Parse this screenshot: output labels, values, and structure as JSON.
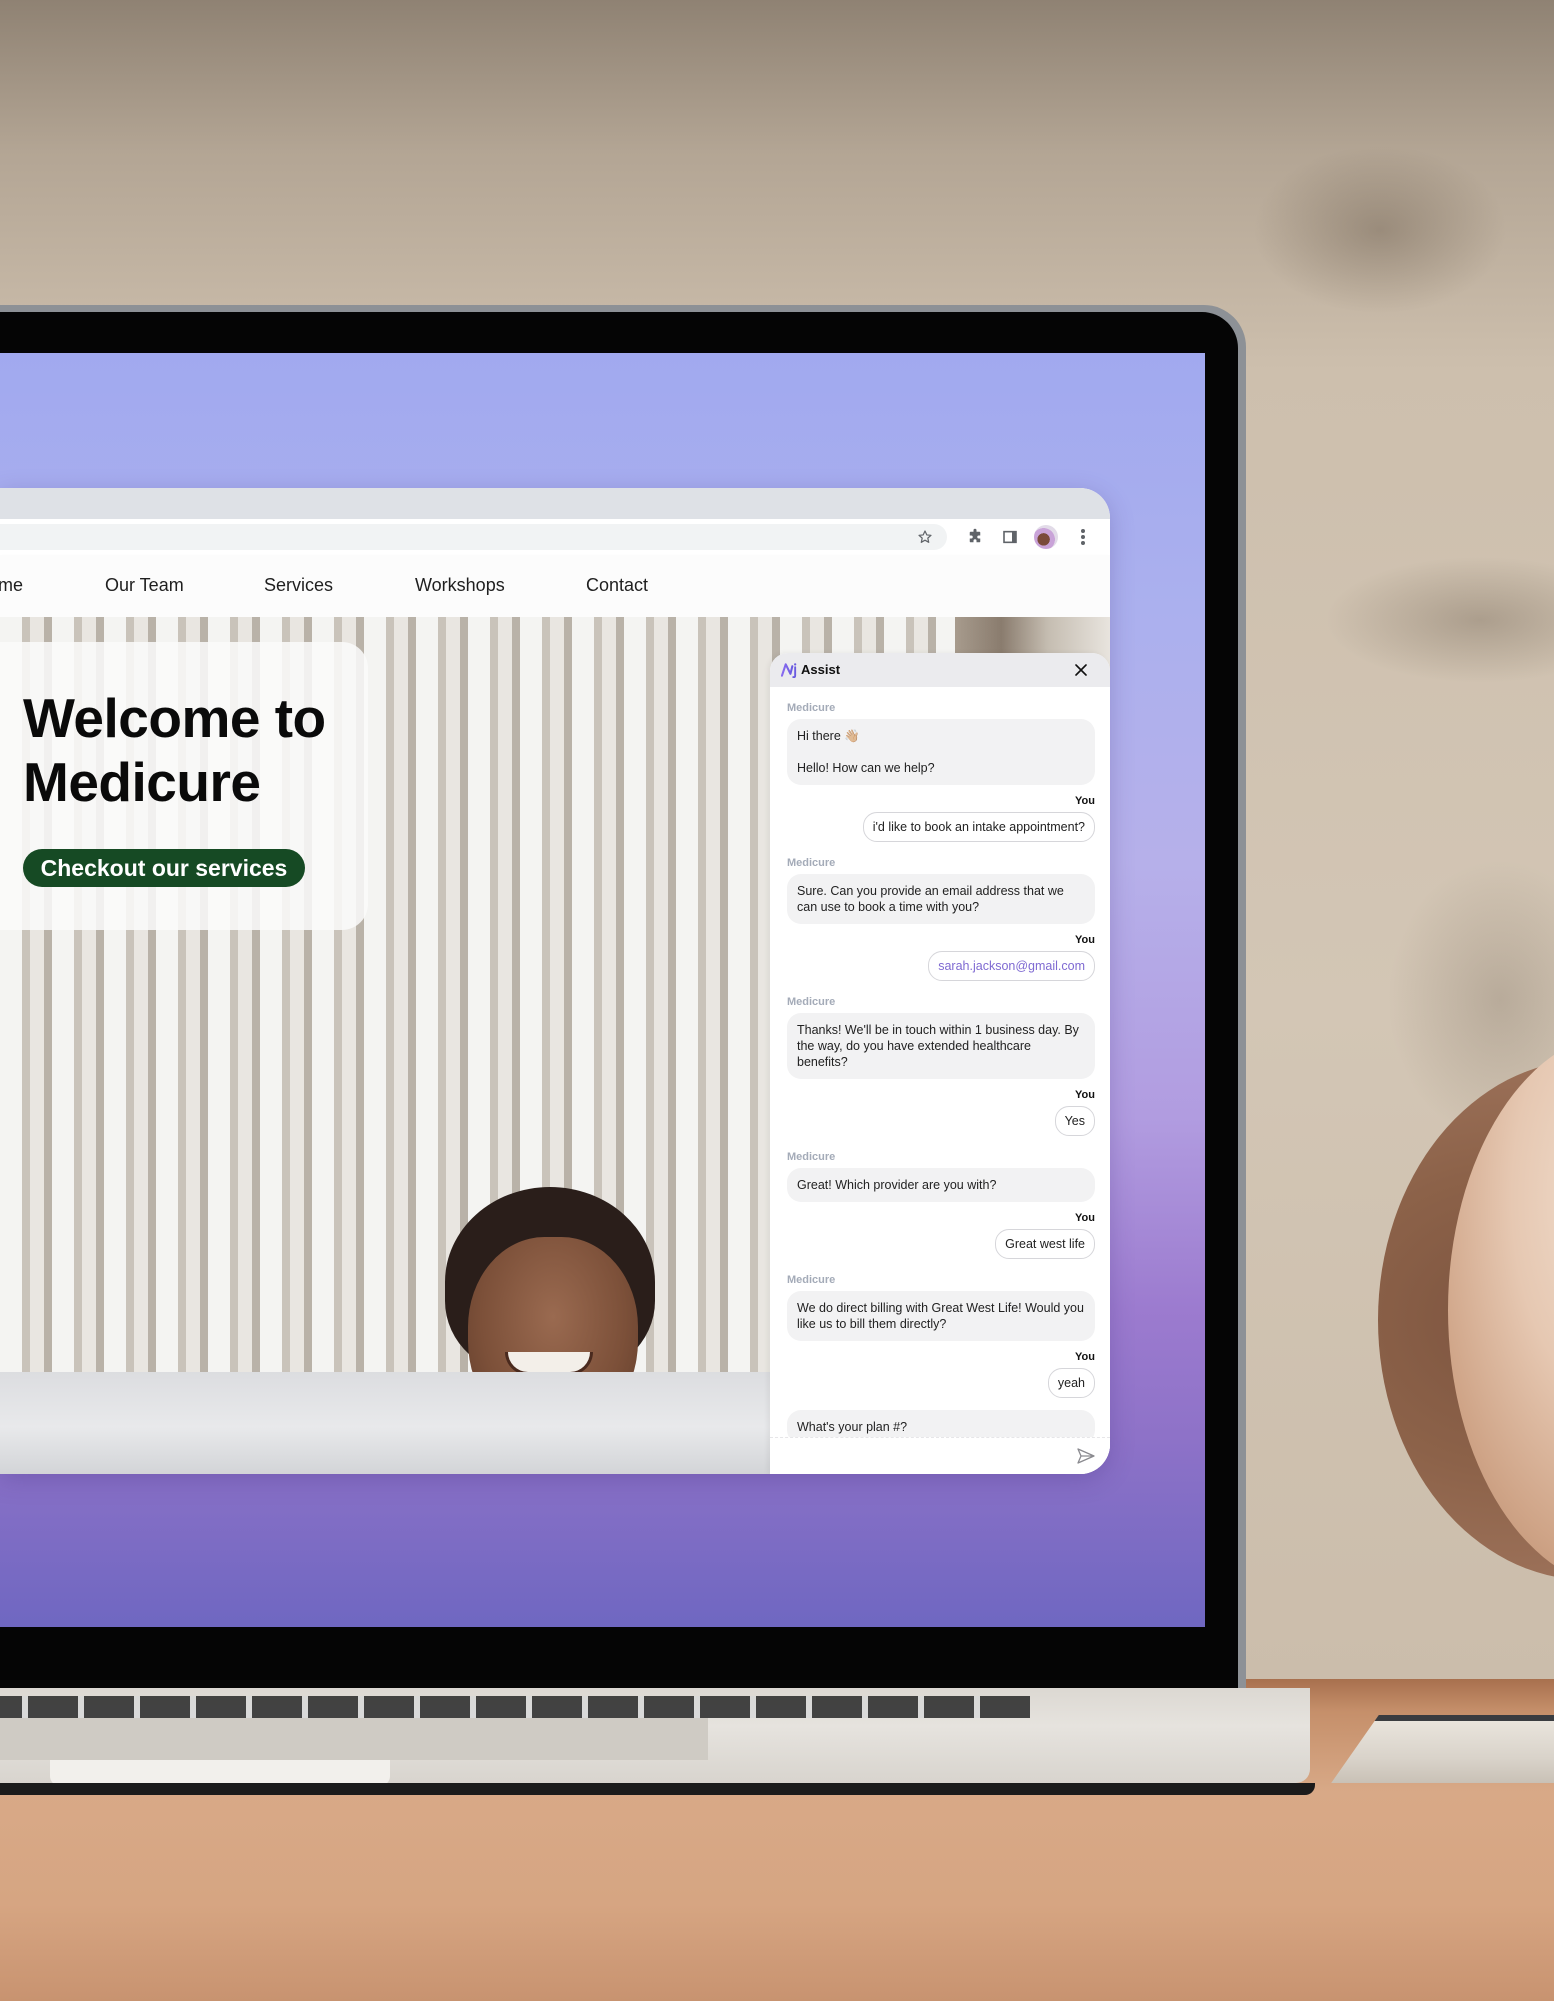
{
  "browser": {
    "toolbar_icons": [
      "star-icon",
      "extensions-puzzle-icon",
      "side-panel-icon",
      "profile-avatar",
      "kebab-menu-icon"
    ]
  },
  "site": {
    "nav": [
      {
        "label": "me"
      },
      {
        "label": "Our Team"
      },
      {
        "label": "Services"
      },
      {
        "label": "Workshops"
      },
      {
        "label": "Contact"
      }
    ],
    "hero": {
      "title_line1": "Welcome to",
      "title_line2": "Medicure",
      "cta_label": "Checkout our services"
    },
    "brand_colors": {
      "cta_background": "#164a24",
      "page_gradient_top": "#a1a9ef",
      "page_gradient_bottom": "#6f67c1"
    }
  },
  "chat": {
    "title": "Assist",
    "bot_name": "Medicure",
    "user_name": "You",
    "accent_color": "#7f6ad2",
    "messages": [
      {
        "from": "bot",
        "text": "Hi there 👋🏼\n\nHello! How can we help?"
      },
      {
        "from": "user",
        "text": "i'd like to book an intake appointment?"
      },
      {
        "from": "bot",
        "text": "Sure. Can you provide an email address that we can use to book a time with you?"
      },
      {
        "from": "user",
        "text": "sarah.jackson@gmail.com",
        "is_email": true
      },
      {
        "from": "bot",
        "text": "Thanks! We'll be in touch within 1 business day. By the way, do you have extended healthcare benefits?"
      },
      {
        "from": "user",
        "text": "Yes"
      },
      {
        "from": "bot",
        "text": "Great! Which provider are you with?"
      },
      {
        "from": "user",
        "text": "Great west life"
      },
      {
        "from": "bot",
        "text": "We do direct billing with Great West Life! Would you like us to bill them directly?"
      },
      {
        "from": "user",
        "text": "yeah"
      },
      {
        "from": "bot",
        "text": "What's your plan #?",
        "continuation": true
      }
    ],
    "input_value": "",
    "input_placeholder": ""
  }
}
